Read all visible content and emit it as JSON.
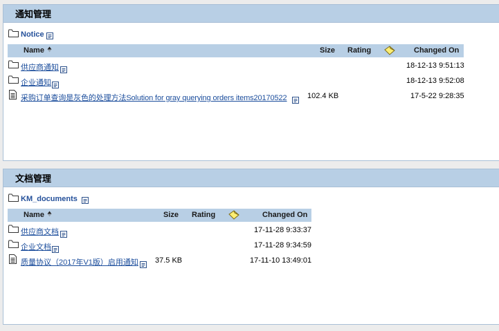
{
  "notices": {
    "title": "通知管理",
    "root_folder": "Notice",
    "columns": {
      "name": "Name",
      "size": "Size",
      "rating": "Rating",
      "changed": "Changed On"
    },
    "rows": [
      {
        "name": "供应商通知",
        "size": "",
        "changed": "18-12-13 9:51:13"
      },
      {
        "name": "企业通知",
        "size": "",
        "changed": "18-12-13 9:52:08"
      },
      {
        "name": "采购订单查询是灰色的处理方法Solution for gray querying orders items20170522",
        "size": "102.4 KB",
        "changed": "17-5-22 9:28:35"
      }
    ]
  },
  "documents": {
    "title": "文档管理",
    "root_folder": "KM_documents",
    "columns": {
      "name": "Name",
      "size": "Size",
      "rating": "Rating",
      "changed": "Changed On"
    },
    "rows": [
      {
        "name": "供应商文档",
        "size": "",
        "changed": "17-11-28 9:33:37"
      },
      {
        "name": "企业文档",
        "size": "",
        "changed": "17-11-28 9:34:59"
      },
      {
        "name": "质量协议（2017年V1版）启用通知",
        "size": "37.5 KB",
        "changed": "17-11-10 13:49:01"
      }
    ]
  }
}
